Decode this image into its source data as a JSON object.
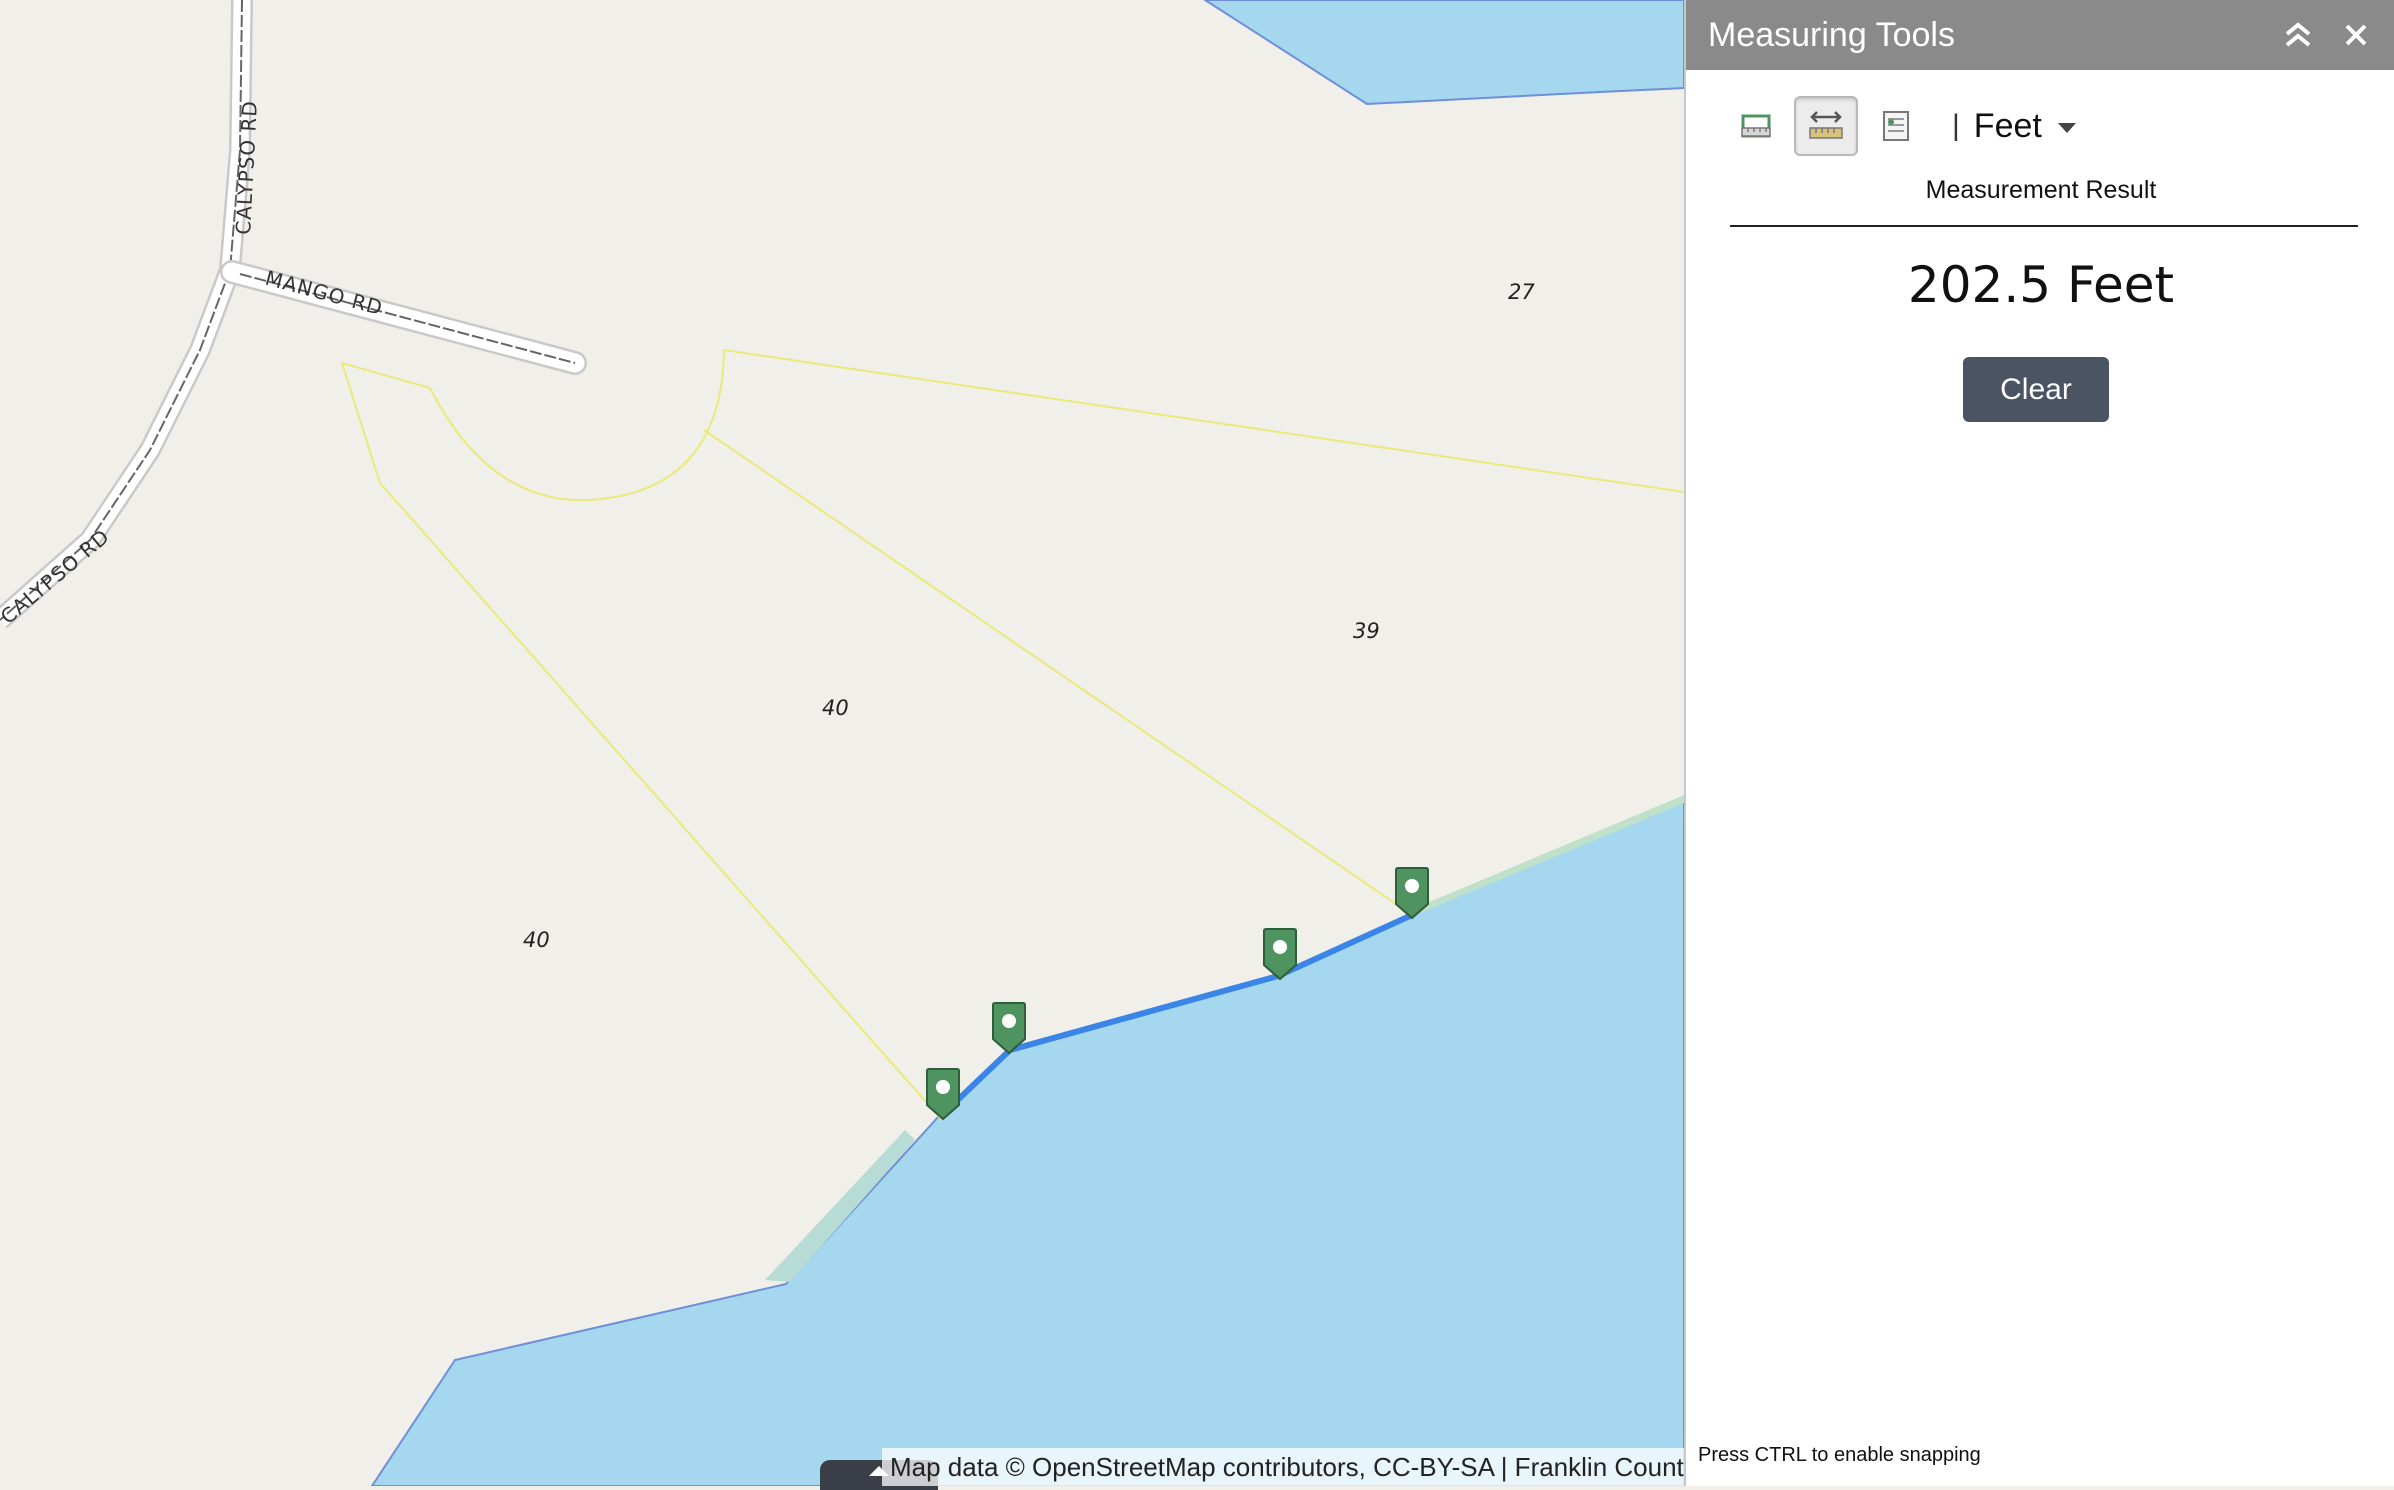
{
  "map": {
    "roads": [
      {
        "label": "CALYPSO RD"
      },
      {
        "label": "MANGO RD"
      },
      {
        "label": "CALYPSO RD"
      }
    ],
    "lots": [
      {
        "label": "27"
      },
      {
        "label": "39"
      },
      {
        "label": "40"
      },
      {
        "label": "40"
      }
    ],
    "attribution": "Map data © OpenStreetMap contributors, CC-BY-SA | Franklin County",
    "colors": {
      "land": "#f0efea",
      "water": "#a5d8ef",
      "parcel": "#eaea7a",
      "measure_line": "#3b84e8",
      "marker": "#4f9460"
    }
  },
  "panel": {
    "title": "Measuring Tools",
    "icons": {
      "collapse": "double-chevron-up-icon",
      "close": "close-icon"
    },
    "tools": [
      {
        "name": "area-tool-icon",
        "active": false
      },
      {
        "name": "distance-tool-icon",
        "active": true
      },
      {
        "name": "location-tool-icon",
        "active": false
      }
    ],
    "separator": "|",
    "unit": "Feet",
    "result_label": "Measurement Result",
    "result_value": "202.5 Feet",
    "clear_label": "Clear",
    "snap_hint": "Press CTRL to enable snapping",
    "colors": {
      "header": "#8a8a8a",
      "clear_button": "#4a5462"
    }
  }
}
